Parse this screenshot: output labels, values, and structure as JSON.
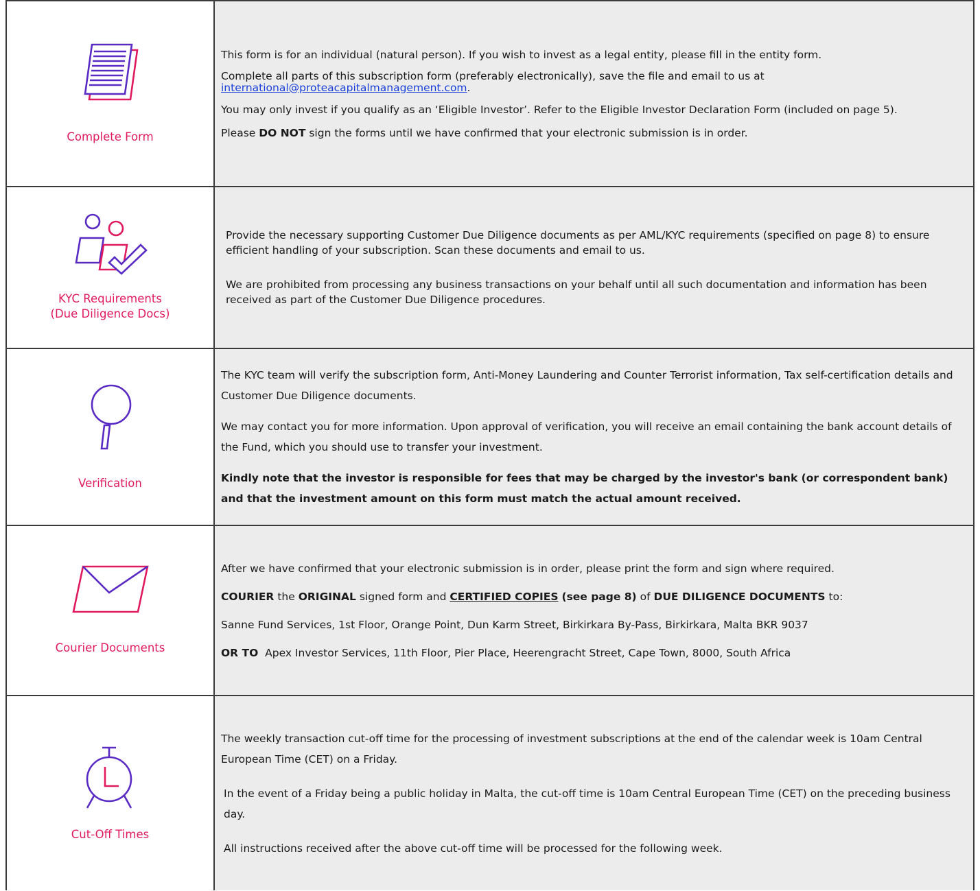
{
  "rows": [
    {
      "icon": "document-icon",
      "caption": "Complete Form",
      "p1": "This form is for an individual (natural person). If you wish to invest as a legal entity, please fill in the entity form.",
      "p2_text": "Complete all parts of this subscription form (preferably electronically), save the file and email to us at",
      "p2_email": "international@proteacapitalmanagement.com",
      "p2_end": ".",
      "p3": "You may only invest if you qualify as an ‘Eligible Investor’. Refer to the Eligible Investor Declaration Form (included on page 5).",
      "p4_pre": "Please",
      "p4_bold": "DO NOT",
      "p4_post": "sign the forms until we have confirmed that your electronic submission is in order."
    },
    {
      "icon": "people-check-icon",
      "caption_line1": "KYC Requirements",
      "caption_line2": "(Due Diligence Docs)",
      "p1": "Provide the necessary supporting Customer Due Diligence documents as per AML/KYC requirements (specified on page 8) to ensure efficient handling of your subscription. Scan these documents and email to us.",
      "p2": "We are prohibited from processing any business transactions on your behalf until all such documentation and information has been received as part of the Customer Due Diligence procedures."
    },
    {
      "icon": "magnifier-icon",
      "caption": "Verification",
      "p1": "The KYC team will verify the subscription form, Anti-Money Laundering and Counter Terrorist information, Tax self-certification details and Customer Due Diligence documents.",
      "p2": "We may contact you for more information. Upon approval of verification, you will receive an email containing the bank account details of the Fund, which you should use to transfer your investment.",
      "p3": "Kindly note that the investor is responsible for fees that may be charged by the investor's bank (or correspondent bank) and that the investment amount on this form must match the actual amount received."
    },
    {
      "icon": "envelope-icon",
      "caption": "Courier Documents",
      "p1": "After we have confirmed that your electronic submission is in order, please print the form and sign where required.",
      "p2_a": "COURIER",
      "p2_b": "the",
      "p2_c": "ORIGINAL",
      "p2_d": "signed form and",
      "p2_e": "CERTIFIED COPIES",
      "p2_f": "(see page 8)",
      "p2_g": "of",
      "p2_h": "DUE DILIGENCE DOCUMENTS",
      "p2_i": "to:",
      "p3": "Sanne Fund Services, 1st Floor, Orange Point, Dun Karm Street, Birkirkara By-Pass, Birkirkara, Malta BKR 9037",
      "p4_bold": "OR TO",
      "p4_rest": "Apex Investor Services, 11th Floor, Pier Place, Heerengracht Street, Cape Town, 8000, South Africa"
    },
    {
      "icon": "stopwatch-icon",
      "caption": "Cut-Off Times",
      "p1": "The weekly transaction cut-off time for the processing of investment subscriptions at the end of the calendar week is 10am Central European Time (CET) on a Friday.",
      "p2": "In the event of a Friday being a public holiday in Malta, the cut-off time is 10am Central European Time (CET) on the preceding business day.",
      "p3": "All instructions received after the above cut-off time will be processed for the following week."
    }
  ],
  "colors": {
    "accent": "#e01a5f",
    "purple": "#5a2bc4",
    "link": "#1a3fd9",
    "cell_bg": "#ececec"
  }
}
